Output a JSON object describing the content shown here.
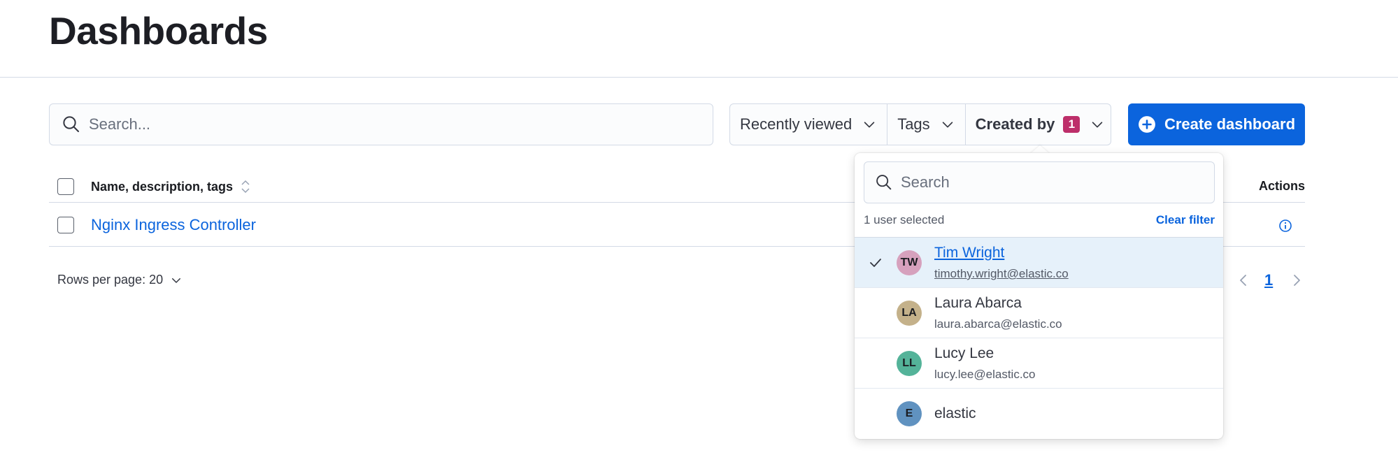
{
  "page": {
    "title": "Dashboards"
  },
  "toolbar": {
    "search_placeholder": "Search...",
    "filters": {
      "recently_viewed": "Recently viewed",
      "tags": "Tags",
      "created_by": "Created by",
      "created_by_count": "1"
    },
    "create_label": "Create dashboard"
  },
  "table": {
    "columns": {
      "name": "Name, description, tags",
      "actions": "Actions"
    },
    "rows": [
      {
        "name": "Nginx Ingress Controller"
      }
    ],
    "rows_per_page": "Rows per page: 20",
    "current_page": "1"
  },
  "popover": {
    "search_placeholder": "Search",
    "status": "1 user selected",
    "clear_label": "Clear filter",
    "users": [
      {
        "initials": "TW",
        "name": "Tim Wright",
        "email": "timothy.wright@elastic.co",
        "selected": true,
        "color": "#d6a1bd"
      },
      {
        "initials": "LA",
        "name": "Laura Abarca",
        "email": "laura.abarca@elastic.co",
        "selected": false,
        "color": "#c4b18a"
      },
      {
        "initials": "LL",
        "name": "Lucy Lee",
        "email": "lucy.lee@elastic.co",
        "selected": false,
        "color": "#54b399"
      },
      {
        "initials": "E",
        "name": "elastic",
        "email": "",
        "selected": false,
        "color": "#6092c0"
      }
    ]
  },
  "colors": {
    "primary": "#0b64dd",
    "badge": "#bd2f6a",
    "selected_row": "#e6f1fa"
  },
  "icons": [
    "search-icon",
    "chevron-down-icon",
    "plus-circle-icon",
    "sort-icon",
    "info-icon",
    "check-icon",
    "chevron-left-icon",
    "chevron-right-icon"
  ]
}
